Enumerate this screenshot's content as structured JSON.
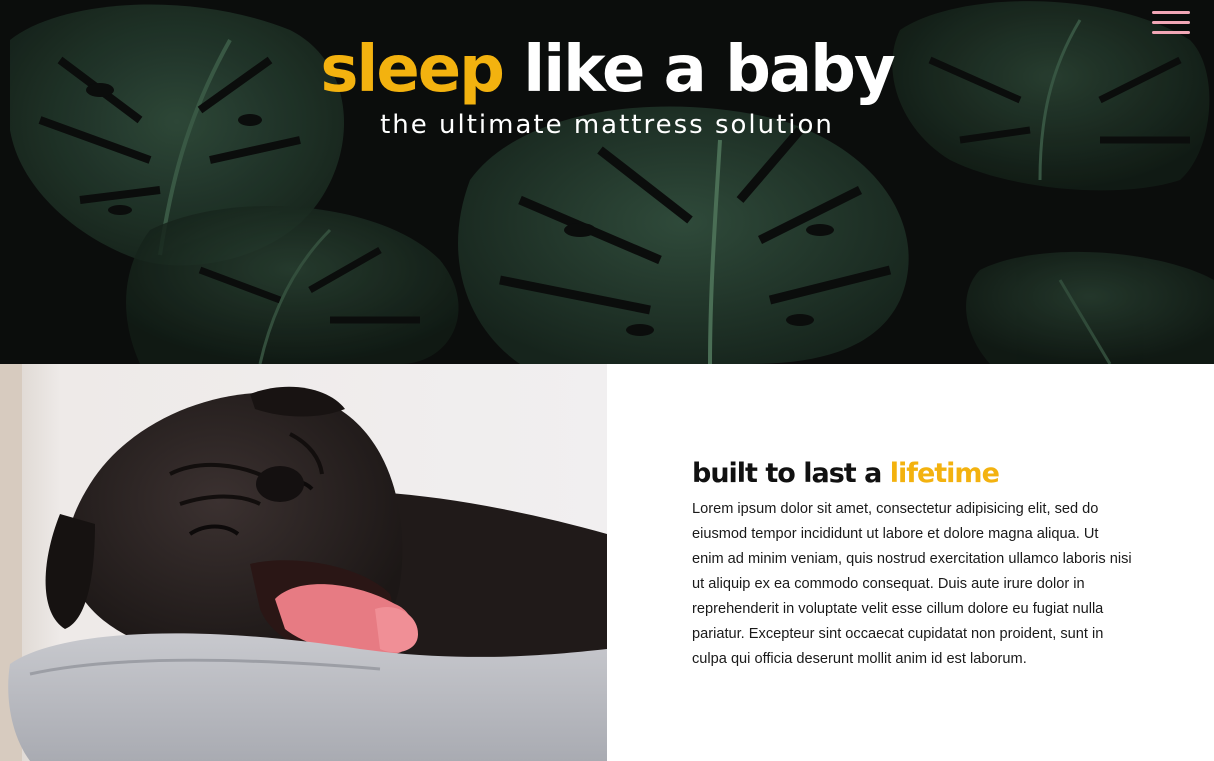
{
  "hero": {
    "title_accent": "sleep",
    "title_rest": "like a baby",
    "subtitle": "the ultimate mattress solution",
    "background_image": "monstera-leaves",
    "menu_icon": "hamburger-menu-icon"
  },
  "feature": {
    "image": "sleeping-pug-on-pillow",
    "heading_main": "built to last a",
    "heading_accent": "lifetime",
    "body": "Lorem ipsum dolor sit amet, consectetur adipisicing elit, sed do eiusmod tempor incididunt ut labore et dolore magna aliqua. Ut enim ad minim veniam, quis nostrud exercitation ullamco laboris nisi ut aliquip ex ea commodo consequat. Duis aute irure dolor in reprehenderit in voluptate velit esse cillum dolore eu fugiat nulla pariatur. Excepteur sint occaecat cupidatat non proident, sunt in culpa qui officia deserunt mollit anim id est laborum."
  },
  "colors": {
    "accent": "#f3b20f",
    "hero_bg": "#0b0d0c",
    "menu_icon": "#f1a6b6",
    "text_dark": "#111111"
  }
}
